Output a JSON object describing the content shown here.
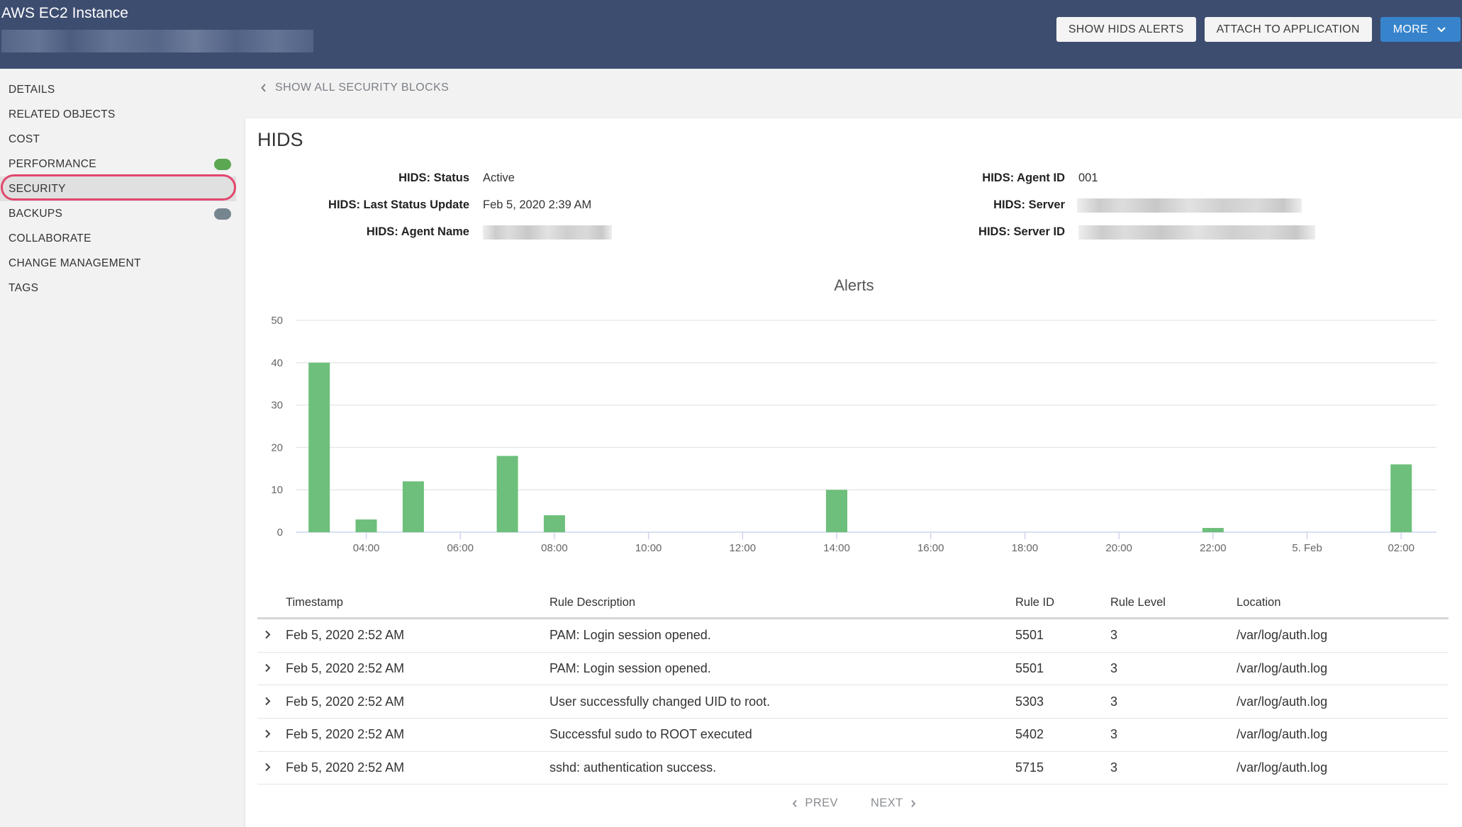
{
  "header": {
    "title": "AWS EC2 Instance",
    "subtitle": "",
    "buttons": {
      "show_hids_alerts": "SHOW HIDS ALERTS",
      "attach_to_application": "ATTACH TO APPLICATION",
      "more": "MORE"
    }
  },
  "sidebar": {
    "items": [
      {
        "label": "DETAILS"
      },
      {
        "label": "RELATED OBJECTS"
      },
      {
        "label": "COST"
      },
      {
        "label": "PERFORMANCE",
        "status_color": "#5aa852"
      },
      {
        "label": "SECURITY",
        "active": true
      },
      {
        "label": "BACKUPS",
        "status_color": "#76868f"
      },
      {
        "label": "COLLABORATE"
      },
      {
        "label": "CHANGE MANAGEMENT"
      },
      {
        "label": "TAGS"
      }
    ]
  },
  "breadcrumb": {
    "back_label": "SHOW ALL SECURITY BLOCKS"
  },
  "hids": {
    "title": "HIDS",
    "fields": {
      "status": {
        "label": "HIDS: Status",
        "value": "Active"
      },
      "last_status_update": {
        "label": "HIDS: Last Status Update",
        "value": "Feb 5, 2020 2:39 AM"
      },
      "agent_name": {
        "label": "HIDS: Agent Name",
        "value": ""
      },
      "agent_id": {
        "label": "HIDS: Agent ID",
        "value": "001"
      },
      "server": {
        "label": "HIDS: Server",
        "value": ""
      },
      "server_id": {
        "label": "HIDS: Server ID",
        "value": ""
      }
    }
  },
  "chart_data": {
    "type": "bar",
    "title": "Alerts",
    "xlabel": "",
    "ylabel": "",
    "ylim": [
      0,
      50
    ],
    "yticks": [
      0,
      10,
      20,
      30,
      40,
      50
    ],
    "grid": true,
    "legend": "none",
    "bar_color": "#6dbf7b",
    "x_start_hour": 2.5,
    "x_end_hour": 26.75,
    "xticks": [
      {
        "hour": 4,
        "label": "04:00"
      },
      {
        "hour": 6,
        "label": "06:00"
      },
      {
        "hour": 8,
        "label": "08:00"
      },
      {
        "hour": 10,
        "label": "10:00"
      },
      {
        "hour": 12,
        "label": "12:00"
      },
      {
        "hour": 14,
        "label": "14:00"
      },
      {
        "hour": 16,
        "label": "16:00"
      },
      {
        "hour": 18,
        "label": "18:00"
      },
      {
        "hour": 20,
        "label": "20:00"
      },
      {
        "hour": 22,
        "label": "22:00"
      },
      {
        "hour": 24,
        "label": "5. Feb"
      },
      {
        "hour": 26,
        "label": "02:00"
      }
    ],
    "categories": [
      "03:00",
      "04:00",
      "05:00",
      "07:00",
      "08:00",
      "14:00",
      "22:00",
      "02:00"
    ],
    "x_hours": [
      3,
      4,
      5,
      7,
      8,
      14,
      22,
      26
    ],
    "values": [
      40,
      3,
      12,
      18,
      4,
      10,
      1,
      16
    ]
  },
  "table": {
    "columns": [
      "Timestamp",
      "Rule Description",
      "Rule ID",
      "Rule Level",
      "Location"
    ],
    "rows": [
      {
        "timestamp": "Feb 5, 2020 2:52 AM",
        "description": "PAM: Login session opened.",
        "rule_id": "5501",
        "rule_level": "3",
        "location": "/var/log/auth.log"
      },
      {
        "timestamp": "Feb 5, 2020 2:52 AM",
        "description": "PAM: Login session opened.",
        "rule_id": "5501",
        "rule_level": "3",
        "location": "/var/log/auth.log"
      },
      {
        "timestamp": "Feb 5, 2020 2:52 AM",
        "description": "User successfully changed UID to root.",
        "rule_id": "5303",
        "rule_level": "3",
        "location": "/var/log/auth.log"
      },
      {
        "timestamp": "Feb 5, 2020 2:52 AM",
        "description": "Successful sudo to ROOT executed",
        "rule_id": "5402",
        "rule_level": "3",
        "location": "/var/log/auth.log"
      },
      {
        "timestamp": "Feb 5, 2020 2:52 AM",
        "description": "sshd: authentication success.",
        "rule_id": "5715",
        "rule_level": "3",
        "location": "/var/log/auth.log"
      }
    ]
  },
  "pager": {
    "prev_label": "PREV",
    "next_label": "NEXT"
  },
  "icons": {
    "chevron_left": "‹",
    "chevron_right": "›",
    "chevron_down": "⌄"
  }
}
